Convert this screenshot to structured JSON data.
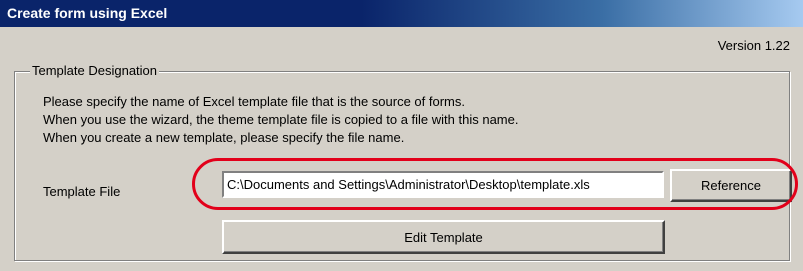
{
  "window": {
    "title": "Create form using Excel",
    "version": "Version 1.22"
  },
  "group": {
    "legend": "Template Designation",
    "description_lines": [
      "Please specify the name of Excel template file that is the source of forms.",
      "When you use the wizard, the theme template file is copied to a file with this name.",
      "When you create a new template, please specify the file name."
    ]
  },
  "template_file": {
    "label": "Template File",
    "value": "C:\\Documents and Settings\\Administrator\\Desktop\\template.xls"
  },
  "buttons": {
    "reference": "Reference",
    "edit_template": "Edit Template"
  },
  "colors": {
    "titlebar_start": "#0a246a",
    "titlebar_end": "#a6caf0",
    "face": "#d4d0c8",
    "highlight_ring": "#e2001a"
  }
}
